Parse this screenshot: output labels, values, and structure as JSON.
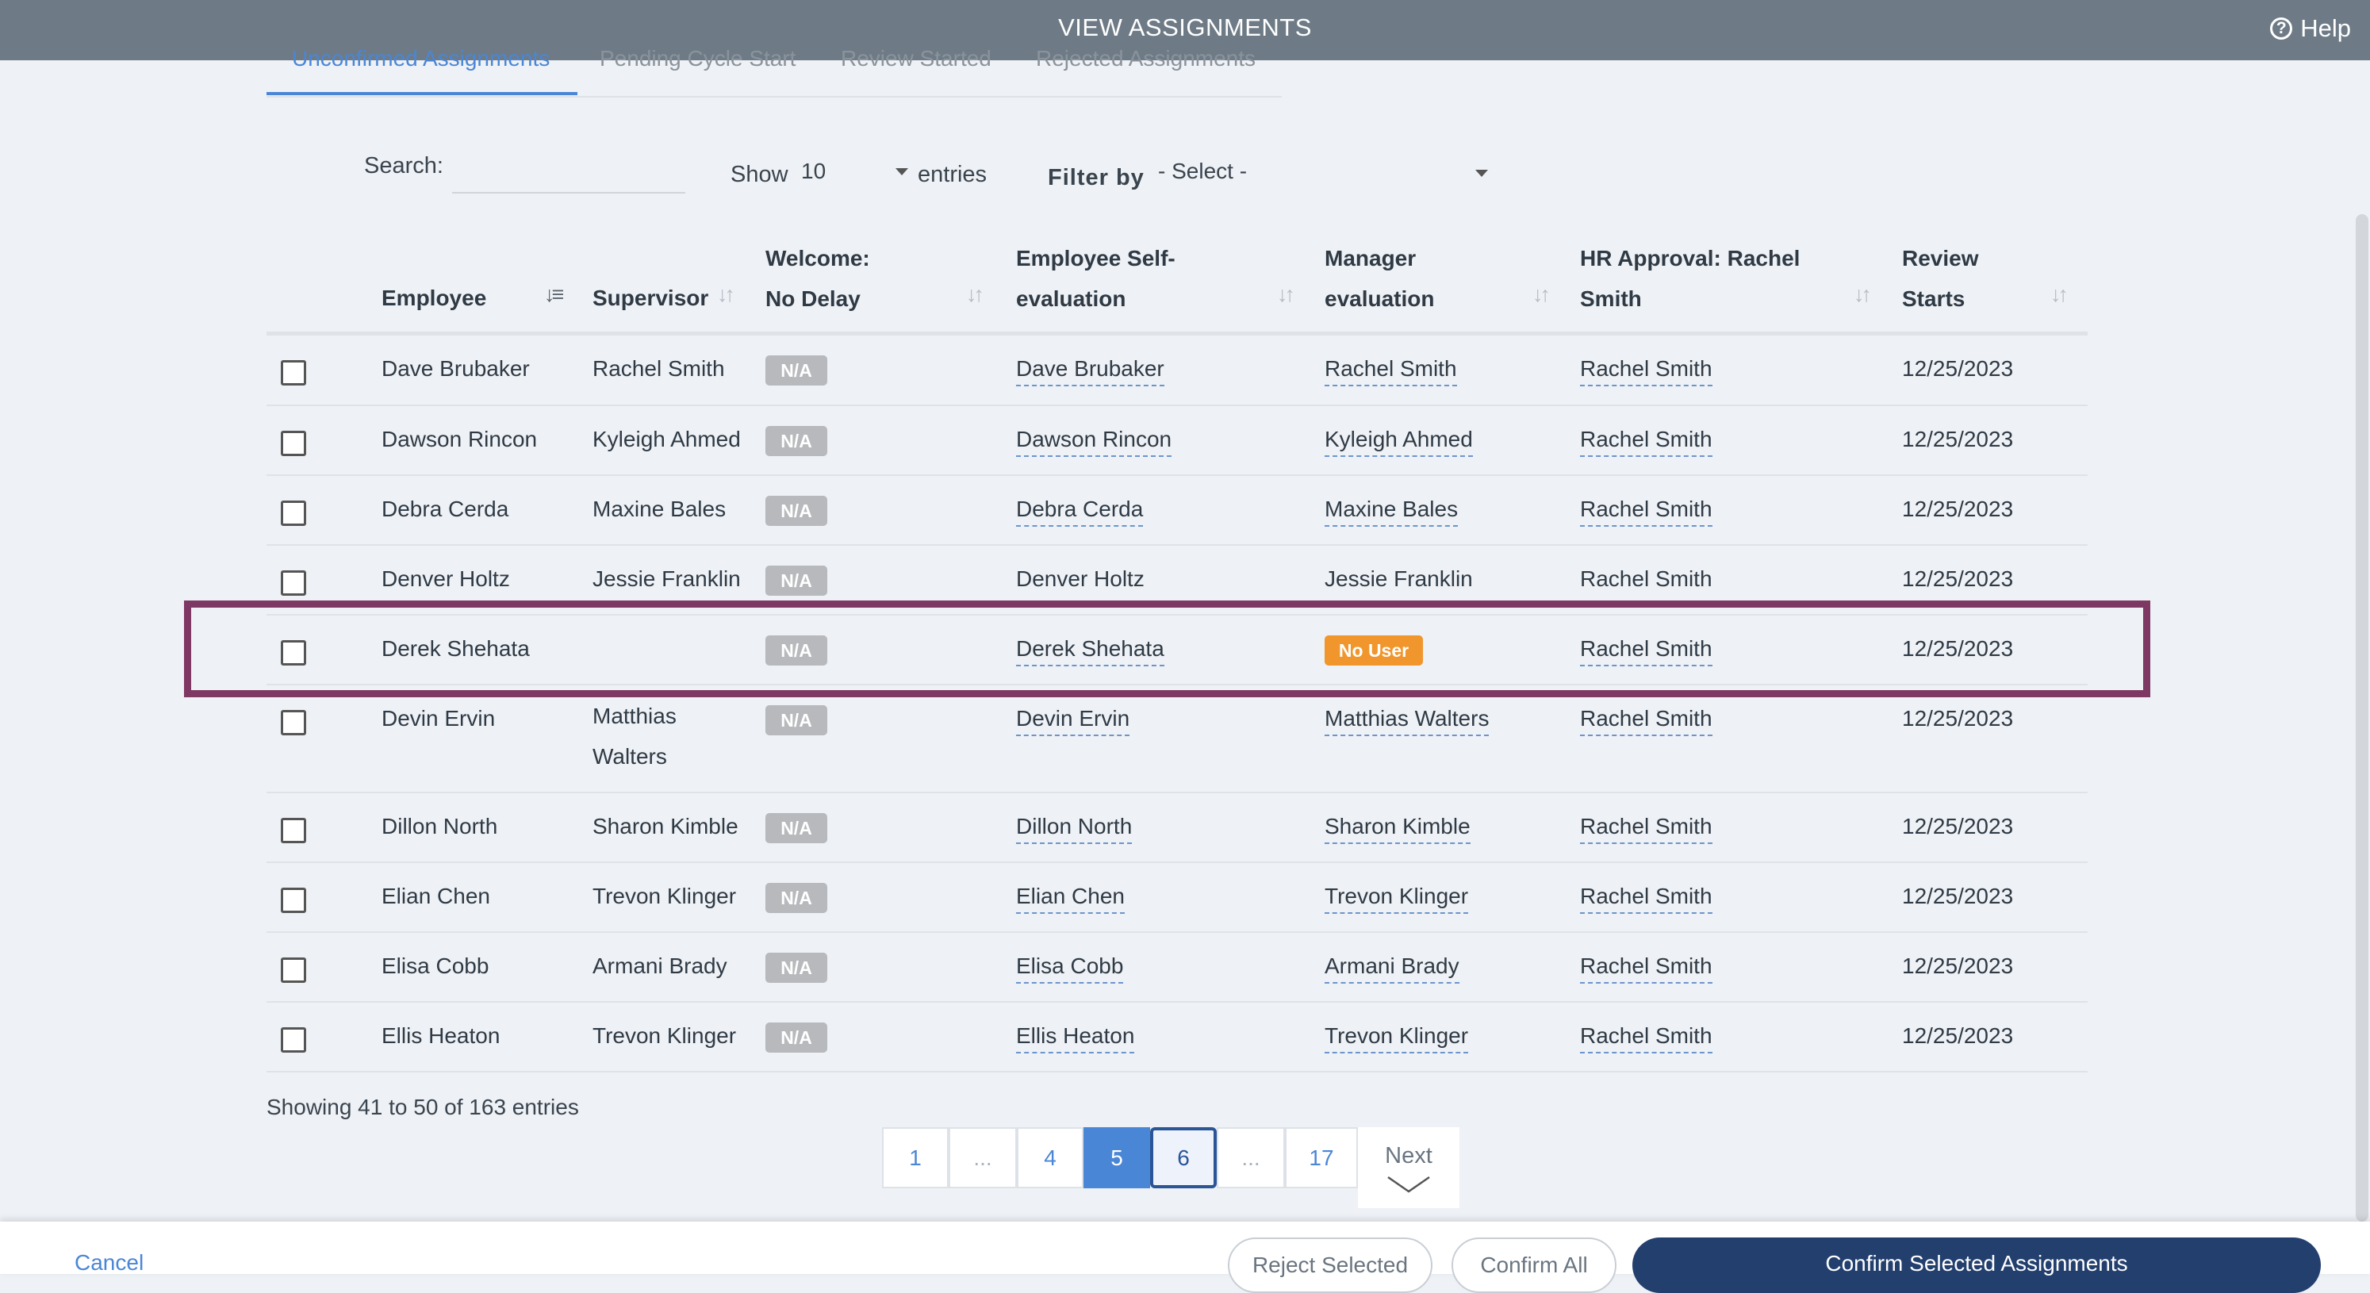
{
  "header": {
    "title": "VIEW ASSIGNMENTS",
    "help_label": "Help"
  },
  "tabs": [
    {
      "label": "Unconfirmed Assignments",
      "active": true
    },
    {
      "label": "Pending Cycle Start"
    },
    {
      "label": "Review Started"
    },
    {
      "label": "Rejected Assignments"
    }
  ],
  "controls": {
    "search_label": "Search:",
    "search_value": "",
    "show_label": "Show",
    "entries_value": "10",
    "entries_label": "entries",
    "filter_label": "Filter by",
    "filter_value": "- Select -"
  },
  "table": {
    "headers": {
      "employee": "Employee",
      "supervisor": "Supervisor",
      "welcome": "Welcome: No Delay",
      "self_eval": "Employee Self-evaluation",
      "manager_eval": "Manager evaluation",
      "hr_approval": "HR Approval: Rachel Smith",
      "review_starts": "Review Starts"
    },
    "rows": [
      {
        "employee": "Dave Brubaker",
        "supervisor": "Rachel Smith",
        "welcome": "N/A",
        "self_eval": "Dave Brubaker",
        "manager_eval": "Rachel Smith",
        "hr_approval": "Rachel Smith",
        "review_starts": "12/25/2023"
      },
      {
        "employee": "Dawson Rincon",
        "supervisor": "Kyleigh Ahmed",
        "welcome": "N/A",
        "self_eval": "Dawson Rincon",
        "manager_eval": "Kyleigh Ahmed",
        "hr_approval": "Rachel Smith",
        "review_starts": "12/25/2023"
      },
      {
        "employee": "Debra Cerda",
        "supervisor": "Maxine Bales",
        "welcome": "N/A",
        "self_eval": "Debra Cerda",
        "manager_eval": "Maxine Bales",
        "hr_approval": "Rachel Smith",
        "review_starts": "12/25/2023"
      },
      {
        "employee": "Denver Holtz",
        "supervisor": "Jessie Franklin",
        "welcome": "N/A",
        "self_eval": "Denver Holtz",
        "manager_eval": "Jessie Franklin",
        "hr_approval": "Rachel Smith",
        "review_starts": "12/25/2023"
      },
      {
        "employee": "Derek Shehata",
        "supervisor": "",
        "welcome": "N/A",
        "self_eval": "Derek Shehata",
        "manager_eval": "No User",
        "hr_approval": "Rachel Smith",
        "review_starts": "12/25/2023"
      },
      {
        "employee": "Devin Ervin",
        "supervisor": "Matthias Walters",
        "welcome": "N/A",
        "self_eval": "Devin Ervin",
        "manager_eval": "Matthias Walters",
        "hr_approval": "Rachel Smith",
        "review_starts": "12/25/2023"
      },
      {
        "employee": "Dillon North",
        "supervisor": "Sharon Kimble",
        "welcome": "N/A",
        "self_eval": "Dillon North",
        "manager_eval": "Sharon Kimble",
        "hr_approval": "Rachel Smith",
        "review_starts": "12/25/2023"
      },
      {
        "employee": "Elian Chen",
        "supervisor": "Trevon Klinger",
        "welcome": "N/A",
        "self_eval": "Elian Chen",
        "manager_eval": "Trevon Klinger",
        "hr_approval": "Rachel Smith",
        "review_starts": "12/25/2023"
      },
      {
        "employee": "Elisa Cobb",
        "supervisor": "Armani Brady",
        "welcome": "N/A",
        "self_eval": "Elisa Cobb",
        "manager_eval": "Armani Brady",
        "hr_approval": "Rachel Smith",
        "review_starts": "12/25/2023"
      },
      {
        "employee": "Ellis Heaton",
        "supervisor": "Trevon Klinger",
        "welcome": "N/A",
        "self_eval": "Ellis Heaton",
        "manager_eval": "Trevon Klinger",
        "hr_approval": "Rachel Smith",
        "review_starts": "12/25/2023"
      }
    ]
  },
  "info": "Showing 41 to 50 of 163 entries",
  "pagination": {
    "pages": [
      "1",
      "...",
      "4",
      "5",
      "6",
      "...",
      "17"
    ],
    "current": "5",
    "focused": "6",
    "next_label": "Next"
  },
  "footer": {
    "cancel_label": "Cancel",
    "reject_label": "Reject Selected",
    "confirm_all_label": "Confirm All",
    "confirm_selected_label": "Confirm Selected Assignments"
  },
  "colors": {
    "header_bg": "#6e7b86",
    "accent": "#4a86d6",
    "primary_button": "#233f6e",
    "highlight_border": "#7d3863",
    "badge_na": "#b7b9bc",
    "badge_no_user": "#f0962c"
  },
  "icons": {
    "help": "question-circle-icon",
    "sort": "sort-arrows-icon",
    "next": "chevron-down-icon"
  }
}
